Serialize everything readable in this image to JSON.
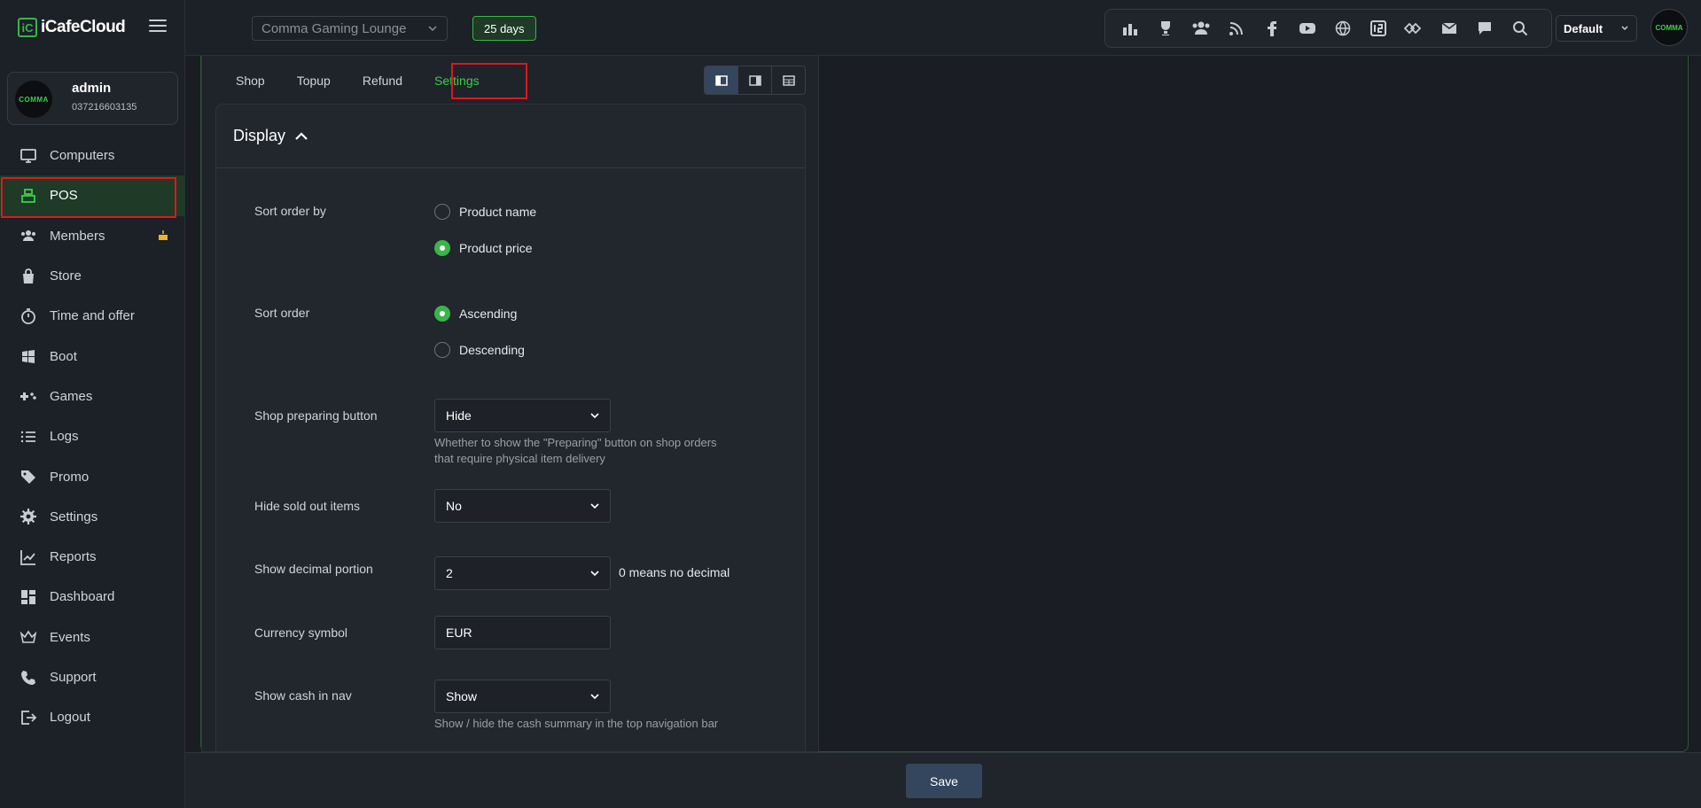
{
  "app": {
    "logo_text": "iCafeCloud",
    "logo_mark": "iC"
  },
  "user": {
    "name": "admin",
    "phone": "037216603135",
    "avatar_text": "COMMA"
  },
  "sidebar": {
    "items": [
      {
        "label": "Computers",
        "icon": "monitor-icon"
      },
      {
        "label": "POS",
        "icon": "cash-register-icon",
        "active": true
      },
      {
        "label": "Members",
        "icon": "users-icon"
      },
      {
        "label": "Store",
        "icon": "shopping-bag-icon"
      },
      {
        "label": "Time and offer",
        "icon": "stopwatch-icon"
      },
      {
        "label": "Boot",
        "icon": "windows-icon"
      },
      {
        "label": "Games",
        "icon": "gamepad-icon"
      },
      {
        "label": "Logs",
        "icon": "list-icon"
      },
      {
        "label": "Promo",
        "icon": "tag-icon"
      },
      {
        "label": "Settings",
        "icon": "gear-icon"
      },
      {
        "label": "Reports",
        "icon": "chart-line-icon"
      },
      {
        "label": "Dashboard",
        "icon": "dashboard-icon"
      },
      {
        "label": "Events",
        "icon": "crown-icon"
      },
      {
        "label": "Support",
        "icon": "phone-icon"
      },
      {
        "label": "Logout",
        "icon": "logout-icon"
      }
    ]
  },
  "topbar": {
    "venue": "Comma Gaming Lounge",
    "days": "25 days",
    "profile": "Default",
    "avatar_text": "COMMA"
  },
  "tabs": [
    "Shop",
    "Topup",
    "Refund",
    "Settings"
  ],
  "section": {
    "title": "Display"
  },
  "settings": {
    "sort_by": {
      "label": "Sort order by",
      "options": [
        "Product name",
        "Product price"
      ],
      "selected": "Product price"
    },
    "sort_order": {
      "label": "Sort order",
      "options": [
        "Ascending",
        "Descending"
      ],
      "selected": "Ascending"
    },
    "preparing": {
      "label": "Shop preparing button",
      "value": "Hide",
      "help_line1": "Whether to show the \"Preparing\" button on shop orders",
      "help_line2": "that require physical item delivery"
    },
    "sold_out": {
      "label": "Hide sold out items",
      "value": "No"
    },
    "decimal": {
      "label": "Show decimal portion",
      "value": "2",
      "note": "0 means no decimal"
    },
    "currency": {
      "label": "Currency symbol",
      "value": "EUR"
    },
    "cash_nav": {
      "label": "Show cash in nav",
      "value": "Show",
      "help": "Show / hide the cash summary in the top navigation bar"
    }
  },
  "footer": {
    "save_label": "Save"
  },
  "colors": {
    "accent": "#3bb54a",
    "highlight": "#e0161e",
    "button": "#34455e"
  }
}
